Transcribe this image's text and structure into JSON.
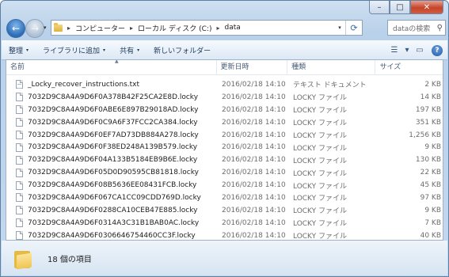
{
  "window": {
    "caption_min": "–",
    "caption_max": "□",
    "caption_close": "✕"
  },
  "nav": {
    "back": "←",
    "forward": "→",
    "dropdown": "▾",
    "breadcrumb": [
      "コンピューター",
      "ローカル ディスク (C:)",
      "data"
    ],
    "separator": "▸",
    "refresh": "⟳",
    "search_placeholder": "dataの検索",
    "search_icon": "⚲"
  },
  "toolbar": {
    "organize": "整理",
    "include_library": "ライブラリに追加",
    "share": "共有",
    "new_folder": "新しいフォルダー",
    "view_icon": "☰",
    "preview_icon": "▭",
    "help": "?"
  },
  "columns": {
    "name": "名前",
    "date": "更新日時",
    "type": "種類",
    "size": "サイズ"
  },
  "files": [
    {
      "name": "_Locky_recover_instructions.txt",
      "date": "2016/02/18 14:10",
      "type": "テキスト ドキュメント",
      "size": "2 KB",
      "icon": "text-file-icon"
    },
    {
      "name": "7032D9C8A4A9D6F0A378B42F25CA2E8D.locky",
      "date": "2016/02/18 14:10",
      "type": "LOCKY ファイル",
      "size": "14 KB",
      "icon": "file-icon"
    },
    {
      "name": "7032D9C8A4A9D6F0ABE6E897B29018AD.locky",
      "date": "2016/02/18 14:10",
      "type": "LOCKY ファイル",
      "size": "197 KB",
      "icon": "file-icon"
    },
    {
      "name": "7032D9C8A4A9D6F0C9A6F37FCC2CA384.locky",
      "date": "2016/02/18 14:10",
      "type": "LOCKY ファイル",
      "size": "351 KB",
      "icon": "file-icon"
    },
    {
      "name": "7032D9C8A4A9D6F0EF7AD73DB884A278.locky",
      "date": "2016/02/18 14:10",
      "type": "LOCKY ファイル",
      "size": "1,256 KB",
      "icon": "file-icon"
    },
    {
      "name": "7032D9C8A4A9D6F0F38ED248A139B579.locky",
      "date": "2016/02/18 14:10",
      "type": "LOCKY ファイル",
      "size": "9 KB",
      "icon": "file-icon"
    },
    {
      "name": "7032D9C8A4A9D6F04A133B5184EB9B6E.locky",
      "date": "2016/02/18 14:10",
      "type": "LOCKY ファイル",
      "size": "130 KB",
      "icon": "file-icon"
    },
    {
      "name": "7032D9C8A4A9D6F05D0D90595CB81818.locky",
      "date": "2016/02/18 14:10",
      "type": "LOCKY ファイル",
      "size": "22 KB",
      "icon": "file-icon"
    },
    {
      "name": "7032D9C8A4A9D6F08B5636EE08431FCB.locky",
      "date": "2016/02/18 14:10",
      "type": "LOCKY ファイル",
      "size": "45 KB",
      "icon": "file-icon"
    },
    {
      "name": "7032D9C8A4A9D6F067CA1CC09CDD769D.locky",
      "date": "2016/02/18 14:10",
      "type": "LOCKY ファイル",
      "size": "97 KB",
      "icon": "file-icon"
    },
    {
      "name": "7032D9C8A4A9D6F0288CA10CEB47E885.locky",
      "date": "2016/02/18 14:10",
      "type": "LOCKY ファイル",
      "size": "9 KB",
      "icon": "file-icon"
    },
    {
      "name": "7032D9C8A4A9D6F0314A3C31B1BAB0AC.locky",
      "date": "2016/02/18 14:10",
      "type": "LOCKY ファイル",
      "size": "7 KB",
      "icon": "file-icon"
    },
    {
      "name": "7032D9C8A4A9D6F0306646754460CC3F.locky",
      "date": "2016/02/18 14:10",
      "type": "LOCKY ファイル",
      "size": "40 KB",
      "icon": "file-icon"
    }
  ],
  "status": {
    "item_count": "18 個の項目"
  },
  "colors": {
    "frame": "#b9d1ea",
    "close_button": "#c5452b",
    "toolbar_text": "#1e395b",
    "muted_text": "#6d6d6d"
  }
}
